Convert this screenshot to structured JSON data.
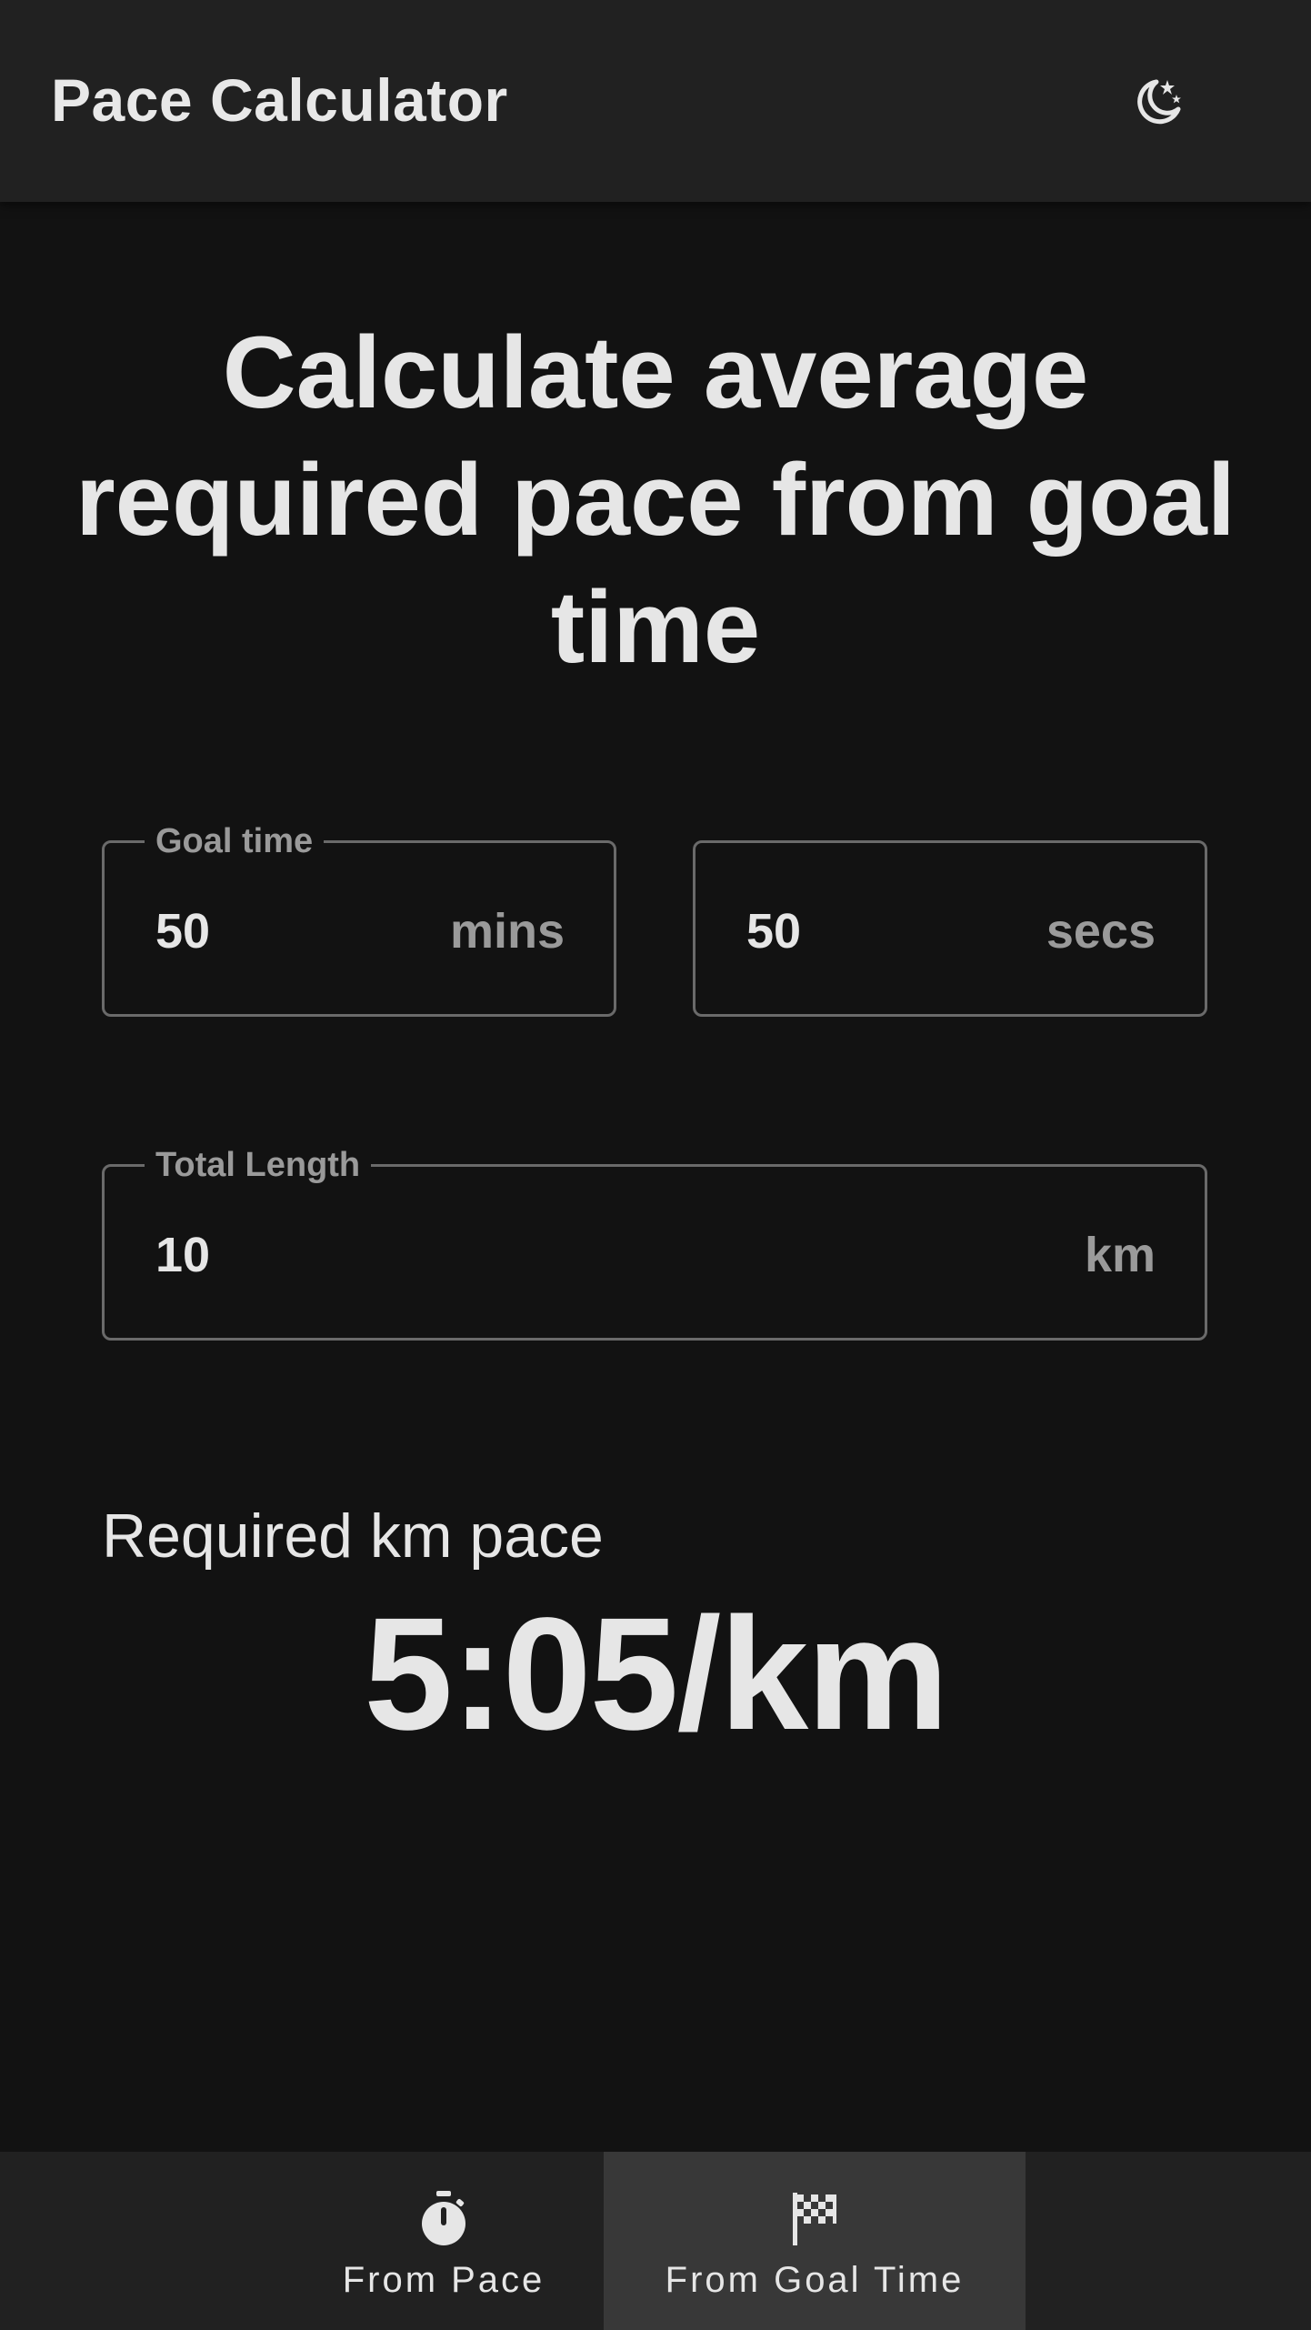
{
  "appbar": {
    "title": "Pace Calculator",
    "theme_icon": "moon-stars-icon"
  },
  "heading": "Calculate average required pace from goal time",
  "goal_time": {
    "label": "Goal time",
    "minutes_value": "50",
    "minutes_unit": "mins",
    "seconds_value": "50",
    "seconds_unit": "secs"
  },
  "total_length": {
    "label": "Total Length",
    "value": "10",
    "unit": "km"
  },
  "result": {
    "label": "Required km pace",
    "value": "5:05/km"
  },
  "bottom_nav": {
    "items": [
      {
        "label": "From Pace",
        "icon": "stopwatch-icon",
        "selected": false
      },
      {
        "label": "From Goal Time",
        "icon": "checkered-flag-icon",
        "selected": true
      }
    ]
  },
  "colors": {
    "background": "#121212",
    "surface": "#212121",
    "selected_nav": "#383838",
    "text": "#e6e6e6",
    "muted": "#9a9a9a",
    "outline": "#6a6a6a"
  }
}
